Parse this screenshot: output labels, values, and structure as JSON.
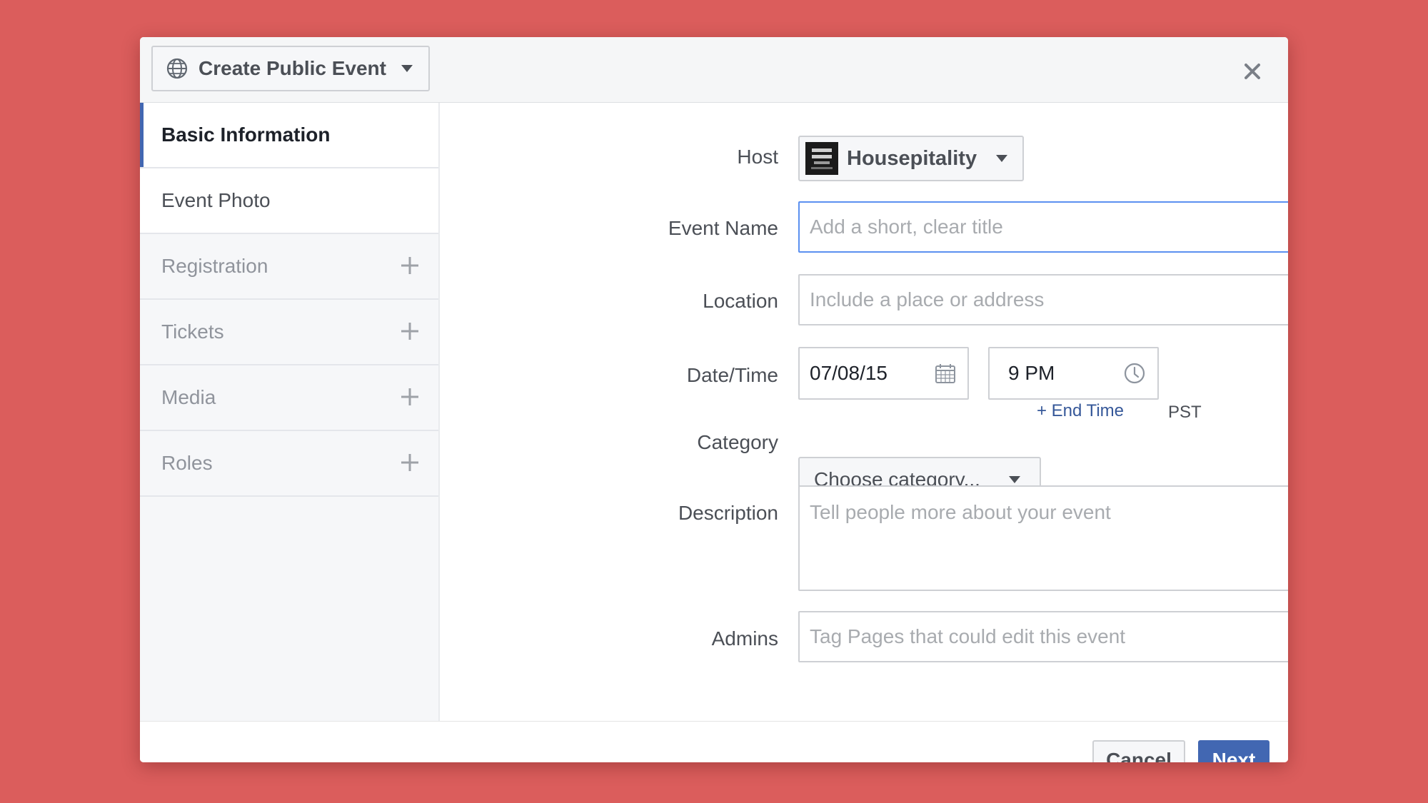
{
  "header": {
    "privacy_label": "Create Public Event",
    "privacy_icon": "globe-icon",
    "close_icon": "close-icon"
  },
  "sidebar": {
    "items": [
      {
        "label": "Basic Information",
        "state": "active"
      },
      {
        "label": "Event Photo",
        "state": "normal"
      },
      {
        "label": "Registration",
        "state": "optional",
        "icon": "plus-icon"
      },
      {
        "label": "Tickets",
        "state": "optional",
        "icon": "plus-icon"
      },
      {
        "label": "Media",
        "state": "optional",
        "icon": "plus-icon"
      },
      {
        "label": "Roles",
        "state": "optional",
        "icon": "plus-icon"
      }
    ]
  },
  "form": {
    "host": {
      "label": "Host",
      "value": "Housepitality"
    },
    "event_name": {
      "label": "Event Name",
      "placeholder": "Add a short, clear title",
      "value": ""
    },
    "location": {
      "label": "Location",
      "placeholder": "Include a place or address",
      "value": ""
    },
    "datetime": {
      "label": "Date/Time",
      "date": "07/08/15",
      "time": "9 PM",
      "timezone": "PST",
      "end_time_link": "+ End Time"
    },
    "category": {
      "label": "Category",
      "value": "Choose category..."
    },
    "description": {
      "label": "Description",
      "placeholder": "Tell people more about your event",
      "value": ""
    },
    "admins": {
      "label": "Admins",
      "placeholder": "Tag Pages that could edit this event",
      "value": ""
    }
  },
  "footer": {
    "cancel_label": "Cancel",
    "next_label": "Next"
  },
  "colors": {
    "background": "#db5d5c",
    "accent": "#4267b2",
    "link": "#365899",
    "focus_border": "#5b90f0"
  }
}
